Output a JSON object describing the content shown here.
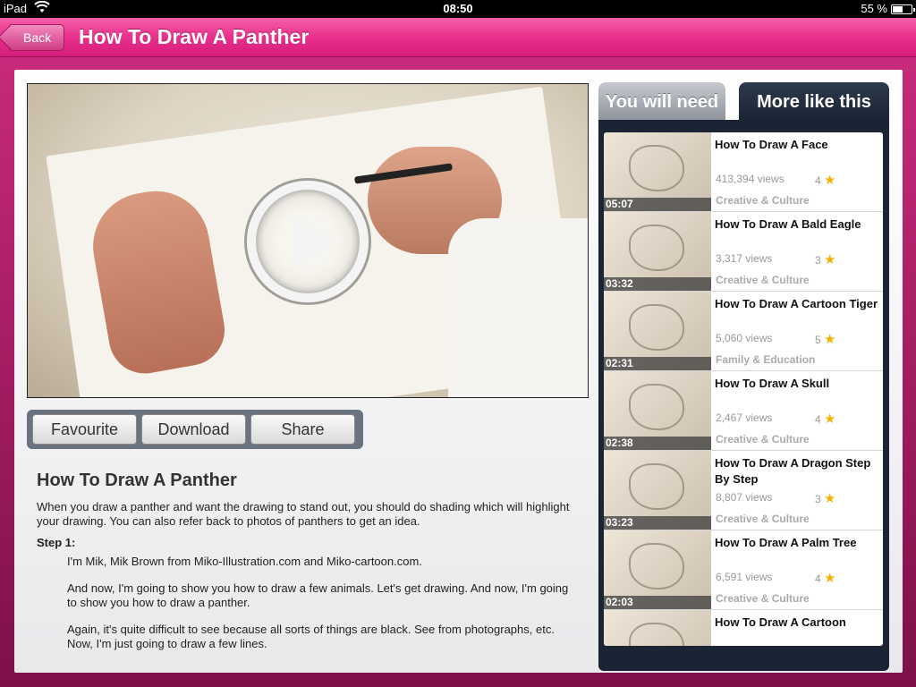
{
  "status": {
    "carrier": "iPad",
    "time": "08:50",
    "battery": "55 %",
    "battery_level": 0.55
  },
  "nav": {
    "back_label": "Back",
    "title": "How To Draw A Panther"
  },
  "actions": {
    "favourite": "Favourite",
    "download": "Download",
    "share": "Share"
  },
  "description": {
    "heading": "How To Draw A Panther",
    "intro": "When you draw a panther and want the drawing to stand out, you should do shading which will highlight your drawing.  You can also refer back to photos of panthers to get an idea.",
    "step_label": "Step 1:",
    "paragraphs": [
      "I'm Mik, Mik Brown from Miko-Illustration.com and Miko-cartoon.com.",
      "And now, I'm going to show you how to draw a few animals.  Let's get drawing.  And now, I'm going to show you how to draw a panther.",
      "Again, it's quite difficult to see because all sorts of things are black.  See from photographs, etc.  Now, I'm just going to draw a few lines."
    ]
  },
  "tabs": {
    "need": "You will need",
    "more": "More like this"
  },
  "videos": [
    {
      "duration": "05:07",
      "title": "How To Draw A Face",
      "views": "413,394 views",
      "rating": "4",
      "category": "Creative & Culture"
    },
    {
      "duration": "03:32",
      "title": "How To Draw A Bald Eagle",
      "views": "3,317 views",
      "rating": "3",
      "category": "Creative & Culture"
    },
    {
      "duration": "02:31",
      "title": "How To Draw A Cartoon Tiger",
      "views": "5,060 views",
      "rating": "5",
      "category": "Family & Education"
    },
    {
      "duration": "02:38",
      "title": "How To  Draw A Skull",
      "views": "2,467 views",
      "rating": "4",
      "category": "Creative & Culture"
    },
    {
      "duration": "03:23",
      "title": "How To Draw A Dragon Step By Step",
      "views": "8,807 views",
      "rating": "3",
      "category": "Creative & Culture"
    },
    {
      "duration": "02:03",
      "title": "How To Draw A Palm Tree",
      "views": "6,591 views",
      "rating": "4",
      "category": "Creative & Culture"
    },
    {
      "duration": "",
      "title": "How To Draw A Cartoon",
      "views": "",
      "rating": "",
      "category": ""
    }
  ],
  "colors": {
    "accent": "#e8308c",
    "sidebar": "#1b2435"
  }
}
